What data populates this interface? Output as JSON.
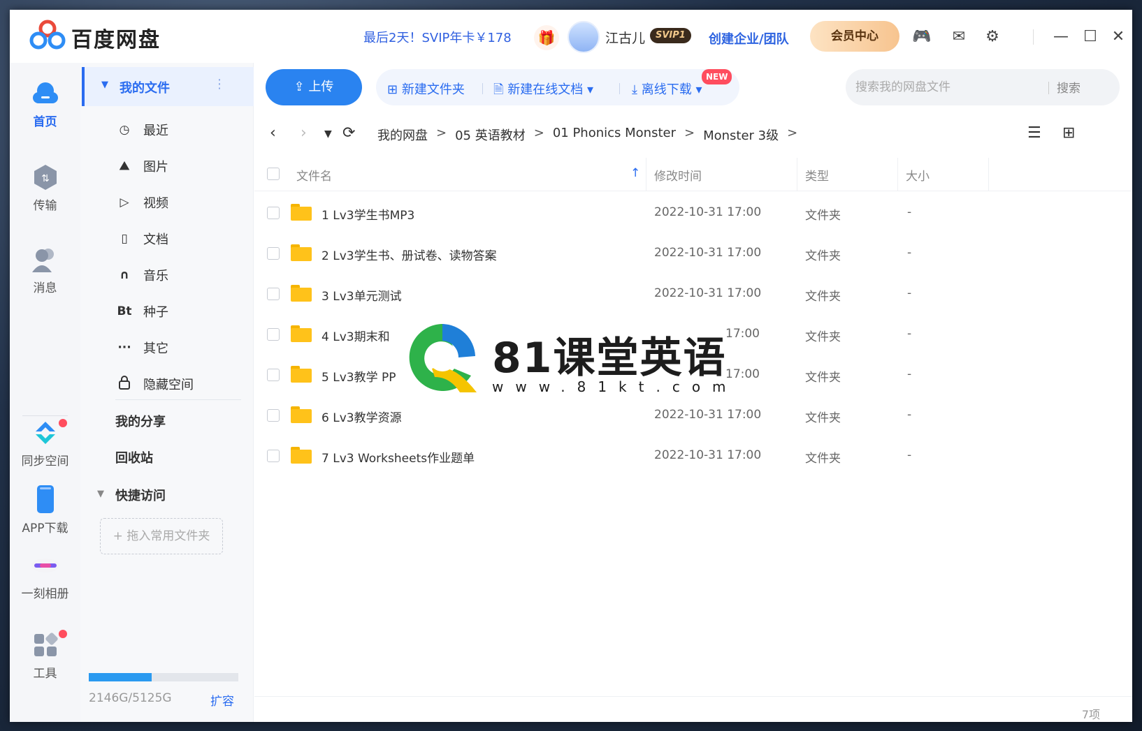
{
  "app": {
    "name": "百度网盘",
    "promo": "最后2天！SVIP年卡￥178",
    "user": "江古儿",
    "svip_badge": "SVIP1",
    "team_link": "创建企业/团队",
    "vip_center": "会员中心"
  },
  "rail": [
    {
      "label": "首页",
      "icon": "cloud-icon"
    },
    {
      "label": "传输",
      "icon": "transfer-icon"
    },
    {
      "label": "消息",
      "icon": "message-icon"
    },
    {
      "label": "同步空间",
      "icon": "sync-icon"
    },
    {
      "label": "APP下载",
      "icon": "phone-icon"
    },
    {
      "label": "一刻相册",
      "icon": "album-icon"
    },
    {
      "label": "工具",
      "icon": "tools-icon"
    }
  ],
  "sidebar": {
    "my_files": "我的文件",
    "items": [
      {
        "label": "最近",
        "icon": "clock-icon",
        "glyph": "◷"
      },
      {
        "label": "图片",
        "icon": "image-icon",
        "glyph": "⛰"
      },
      {
        "label": "视频",
        "icon": "play-icon",
        "glyph": "▷"
      },
      {
        "label": "文档",
        "icon": "document-icon",
        "glyph": "▯"
      },
      {
        "label": "音乐",
        "icon": "headphone-icon",
        "glyph": "∩"
      },
      {
        "label": "种子",
        "icon": "bt-icon",
        "glyph": "Bt"
      },
      {
        "label": "其它",
        "icon": "more-icon",
        "glyph": "···"
      },
      {
        "label": "隐藏空间",
        "icon": "lock-icon",
        "glyph": "🔒"
      }
    ],
    "my_share": "我的分享",
    "recycle": "回收站",
    "quick_access": "快捷访问",
    "drop_hint": "+ 拖入常用文件夹",
    "quota_text": "2146G/5125G",
    "quota_used_fraction": 0.419,
    "expand": "扩容"
  },
  "toolbar": {
    "upload": "上传",
    "new_folder": "新建文件夹",
    "new_doc": "新建在线文档",
    "new_badge": "NEW",
    "offline_download": "离线下载",
    "search_placeholder": "搜索我的网盘文件",
    "search_button": "搜索"
  },
  "breadcrumb": [
    "我的网盘",
    "05 英语教材",
    "01 Phonics Monster",
    "Monster 3级"
  ],
  "table": {
    "headers": {
      "name": "文件名",
      "modified": "修改时间",
      "type": "类型",
      "size": "大小"
    },
    "rows": [
      {
        "name": "1 Lv3学生书MP3",
        "modified": "2022-10-31 17:00",
        "type": "文件夹",
        "size": "-"
      },
      {
        "name": "2 Lv3学生书、册试卷、读物答案",
        "modified": "2022-10-31 17:00",
        "type": "文件夹",
        "size": "-"
      },
      {
        "name": "3 Lv3单元测试",
        "modified": "2022-10-31 17:00",
        "type": "文件夹",
        "size": "-"
      },
      {
        "name": "4 Lv3期末和",
        "modified": "17:00",
        "type": "文件夹",
        "size": "-"
      },
      {
        "name": "5 Lv3教学 PP",
        "modified": "17:00",
        "type": "文件夹",
        "size": "-"
      },
      {
        "name": "6 Lv3教学资源",
        "modified": "2022-10-31 17:00",
        "type": "文件夹",
        "size": "-"
      },
      {
        "name": "7 Lv3 Worksheets作业题单",
        "modified": "2022-10-31 17:00",
        "type": "文件夹",
        "size": "-"
      }
    ],
    "count": "7项"
  },
  "watermark": {
    "title": "81课堂英语",
    "url": "www.81kt.com"
  },
  "colors": {
    "accent": "#2a6cf0",
    "upload": "#2a83f0",
    "folder": "#ffc21a",
    "badge": "#ff4d5e"
  }
}
